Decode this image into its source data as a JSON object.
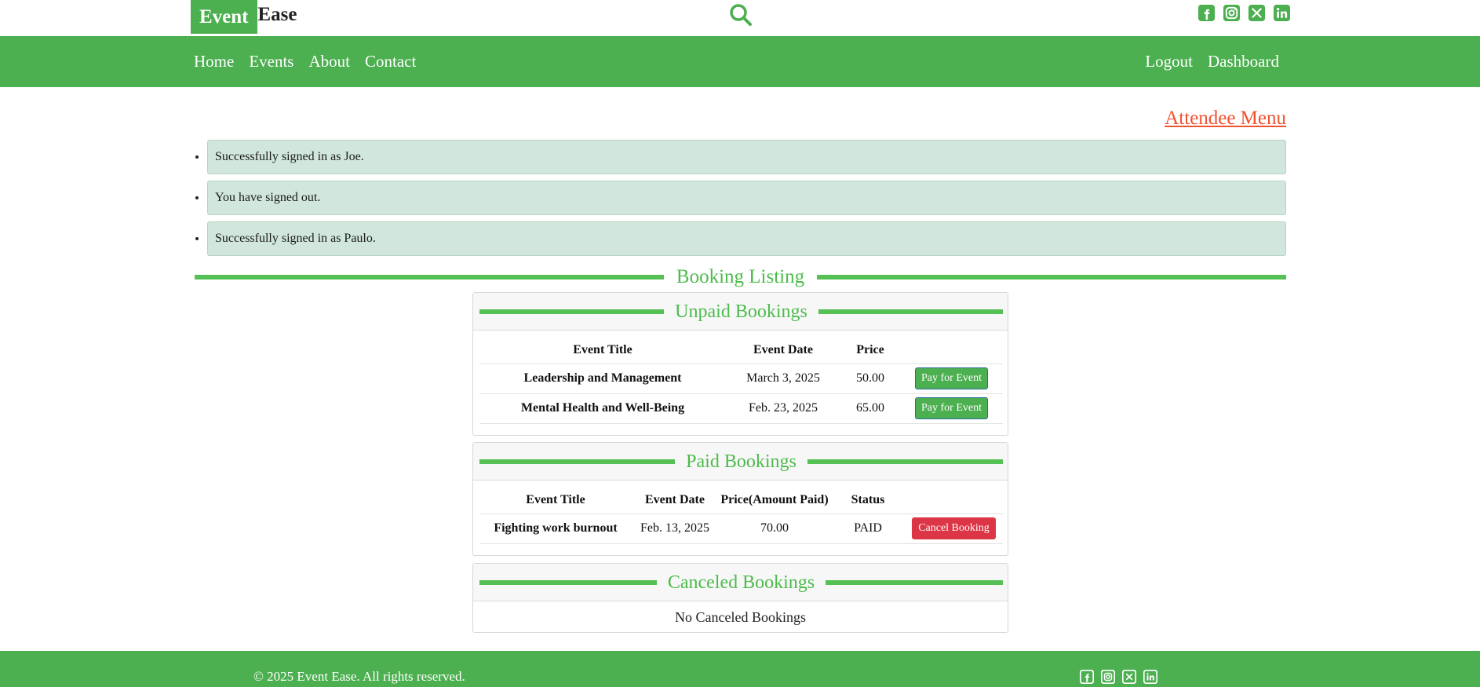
{
  "brand": {
    "part1": "Event",
    "part2": "Ease"
  },
  "nav": {
    "left": [
      "Home",
      "Events",
      "About",
      "Contact"
    ],
    "right": [
      "Logout",
      "Dashboard"
    ]
  },
  "attendee_menu": "Attendee Menu",
  "messages": [
    "Successfully signed in as Joe.",
    "You have signed out.",
    "Successfully signed in as Paulo."
  ],
  "booking_listing": "Booking Listing",
  "unpaid": {
    "title": "Unpaid Bookings",
    "headers": [
      "Event Title",
      "Event Date",
      "Price"
    ],
    "rows": [
      {
        "title": "Leadership and Management",
        "date": "March 3, 2025",
        "price": "50.00",
        "action": "Pay for Event"
      },
      {
        "title": "Mental Health and Well-Being",
        "date": "Feb. 23, 2025",
        "price": "65.00",
        "action": "Pay for Event"
      }
    ]
  },
  "paid": {
    "title": "Paid Bookings",
    "headers": [
      "Event Title",
      "Event Date",
      "Price(Amount Paid)",
      "Status"
    ],
    "rows": [
      {
        "title": "Fighting work burnout",
        "date": "Feb. 13, 2025",
        "price": "70.00",
        "status": "PAID",
        "action": "Cancel Booking"
      }
    ]
  },
  "canceled": {
    "title": "Canceled Bookings",
    "empty": "No Canceled Bookings"
  },
  "footer": {
    "copyright": "© 2025 Event Ease. All rights reserved."
  },
  "colors": {
    "brand_green": "#4caf50",
    "accent_orange": "#f0522f",
    "danger_red": "#dc3545",
    "alert_bg": "#d1e7dd"
  },
  "icons": {
    "search": "search-icon",
    "social": [
      "facebook-icon",
      "instagram-icon",
      "x-icon",
      "linkedin-icon"
    ]
  }
}
